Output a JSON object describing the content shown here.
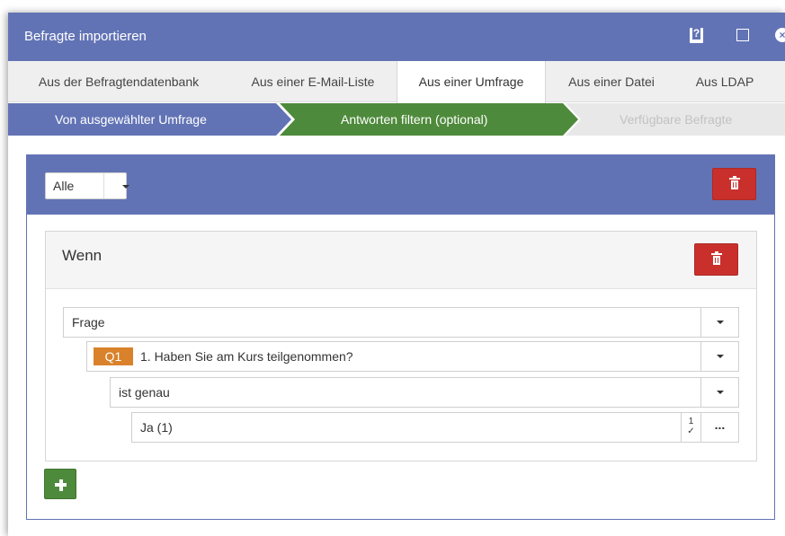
{
  "window": {
    "title": "Befragte importieren",
    "help_glyph": "?",
    "close_glyph": "×"
  },
  "tabs": [
    {
      "label": "Aus der Befragtendatenbank",
      "active": false
    },
    {
      "label": "Aus einer E-Mail-Liste",
      "active": false
    },
    {
      "label": "Aus einer Umfrage",
      "active": true
    },
    {
      "label": "Aus einer Datei",
      "active": false
    },
    {
      "label": "Aus LDAP",
      "active": false
    }
  ],
  "steps": [
    {
      "label": "Von ausgewählter Umfrage",
      "state": "done"
    },
    {
      "label": "Antworten filtern (optional)",
      "state": "current"
    },
    {
      "label": "Verfügbare Befragte",
      "state": "disabled"
    }
  ],
  "group": {
    "match_select": "Alle"
  },
  "condition": {
    "header": "Wenn",
    "type_select": "Frage",
    "question_badge": "Q1",
    "question_text": "1. Haben Sie am Kurs teilgenommen?",
    "operator_select": "ist genau",
    "value_field": "Ja (1)",
    "numeric_glyph": "1",
    "more_glyph": "..."
  },
  "colors": {
    "primary": "#6273b5",
    "success": "#4e8a3b",
    "danger": "#c9302c",
    "badge": "#d9822b"
  },
  "icons": {
    "help": "help-icon",
    "maximize": "maximize-icon",
    "close": "close-icon",
    "delete": "trash-icon",
    "add": "plus-icon",
    "dropdown": "caret-down-icon"
  }
}
